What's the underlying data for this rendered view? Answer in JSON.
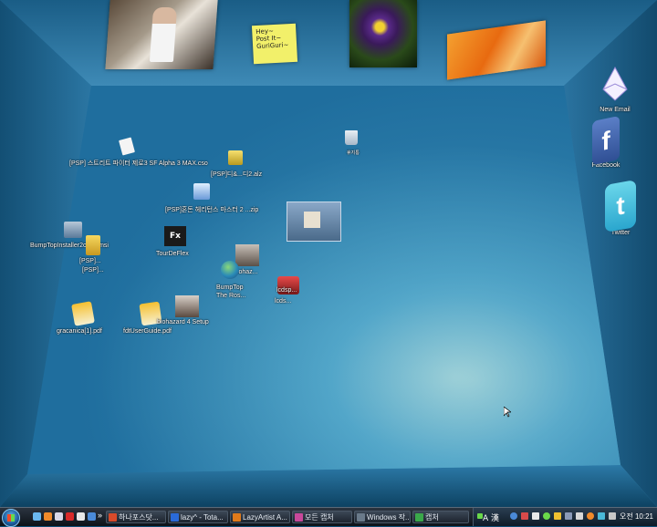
{
  "wall_photos": {
    "photo1": "person-photo",
    "post_it_text": "Hey~\nPost It~\nGuriGuri~",
    "photo2": "flower-photo",
    "photo3": "orange-photo"
  },
  "side_apps": [
    {
      "label": "New Email",
      "icon": "new-email-icon"
    },
    {
      "label": "Facebook",
      "icon": "facebook-icon"
    },
    {
      "label": "Twitter",
      "icon": "twitter-icon"
    }
  ],
  "desktop_items": {
    "cso": "[PSP] 스트리트 파이터 제로3 SF Alpha 3 MAX.cso",
    "recycle": "휴지통",
    "alz": "[PSP]디&...디2.alz",
    "zip": "[PSP]혼돈 헤리턴스 마스터 2 ...zip",
    "installer": "BumpTopInstaller2c38...msi",
    "psp1": "[PSP]...",
    "psp2": "[PSP]...",
    "tourdeflex": "TourDeFlex",
    "biohaz1": "biohaz...",
    "bumptop": "BumpTop\nThe Ros...",
    "lcd1": "lcdsp...",
    "lcd2": "lcds...",
    "gracanica": "gracanica[1].pdf",
    "fdt": "fdtUserGuide.pdf",
    "biohazard_setup": "biohazard 4 Setup"
  },
  "taskbar": {
    "buttons": [
      {
        "label": "하나포스닷...",
        "color": "#d84a2a"
      },
      {
        "label": "lazy^ - Tota...",
        "color": "#2a6ad8"
      },
      {
        "label": "LazyArtist A...",
        "color": "#e07a1a"
      },
      {
        "label": "모든 캡처",
        "color": "#c8489a"
      },
      {
        "label": "Windows 작...",
        "color": "#6a7a8a"
      },
      {
        "label": "캡처",
        "color": "#3aa84a"
      }
    ],
    "tray_text": "A 漢",
    "clock": "오전 10:21"
  }
}
